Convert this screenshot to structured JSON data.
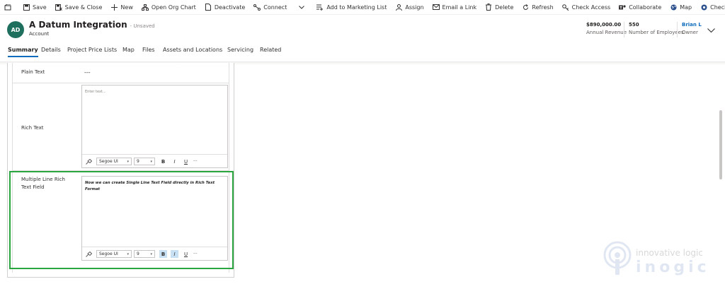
{
  "command_bar": {
    "items": [
      {
        "label": "",
        "icon": "back-window-icon"
      },
      {
        "label": "Save",
        "icon": "save-icon"
      },
      {
        "label": "Save & Close",
        "icon": "save-close-icon"
      },
      {
        "label": "New",
        "icon": "plus-icon"
      },
      {
        "label": "Open Org Chart",
        "icon": "org-chart-icon"
      },
      {
        "label": "Deactivate",
        "icon": "document-icon"
      },
      {
        "label": "Connect",
        "icon": "connect-icon"
      },
      {
        "label": "",
        "icon": "chevron-down-icon"
      },
      {
        "label": "Add to Marketing List",
        "icon": "list-add-icon"
      },
      {
        "label": "Assign",
        "icon": "person-icon"
      },
      {
        "label": "Email a Link",
        "icon": "mail-icon"
      },
      {
        "label": "Delete",
        "icon": "trash-icon"
      },
      {
        "label": "Refresh",
        "icon": "refresh-icon"
      },
      {
        "label": "Check Access",
        "icon": "key-icon"
      },
      {
        "label": "Collaborate",
        "icon": "teams-icon"
      },
      {
        "label": "Map",
        "icon": "globe-icon"
      },
      {
        "label": "Check-In",
        "icon": "checkin-icon"
      },
      {
        "label": "",
        "icon": "more-vertical-icon"
      }
    ]
  },
  "header": {
    "initials": "AD",
    "title": "A Datum Integration",
    "status": "- Unsaved",
    "entity": "Account",
    "fields": [
      {
        "value": "$890,000.00",
        "label": "Annual Revenue"
      },
      {
        "value": "550",
        "label": "Number of Employees"
      },
      {
        "value": "Brian L",
        "label": "Owner"
      }
    ]
  },
  "tabs": [
    "Summary",
    "Details",
    "Project Price Lists",
    "Map",
    "Files",
    "Assets and Locations",
    "Servicing",
    "Related"
  ],
  "active_tab": "Summary",
  "form": {
    "plain_text": {
      "label": "Plain Text",
      "value": "---"
    },
    "rich_text": {
      "label": "Rich Text",
      "placeholder": "Enter text..."
    },
    "multi_rich": {
      "label": "Multiple Line Rich Text Field",
      "content": "Now we can create Single Line Text Field directly in Rich Text Format"
    },
    "toolbar": {
      "font": "Segoe UI",
      "size": "9",
      "bold": "B",
      "italic": "I",
      "underline": "U",
      "more": "···"
    }
  },
  "watermark": {
    "tagline": "innovative logic",
    "brand": "inogic"
  },
  "colors": {
    "accent": "#0f6cbd",
    "avatar": "#1f6f5e",
    "highlight": "#2aa540"
  }
}
